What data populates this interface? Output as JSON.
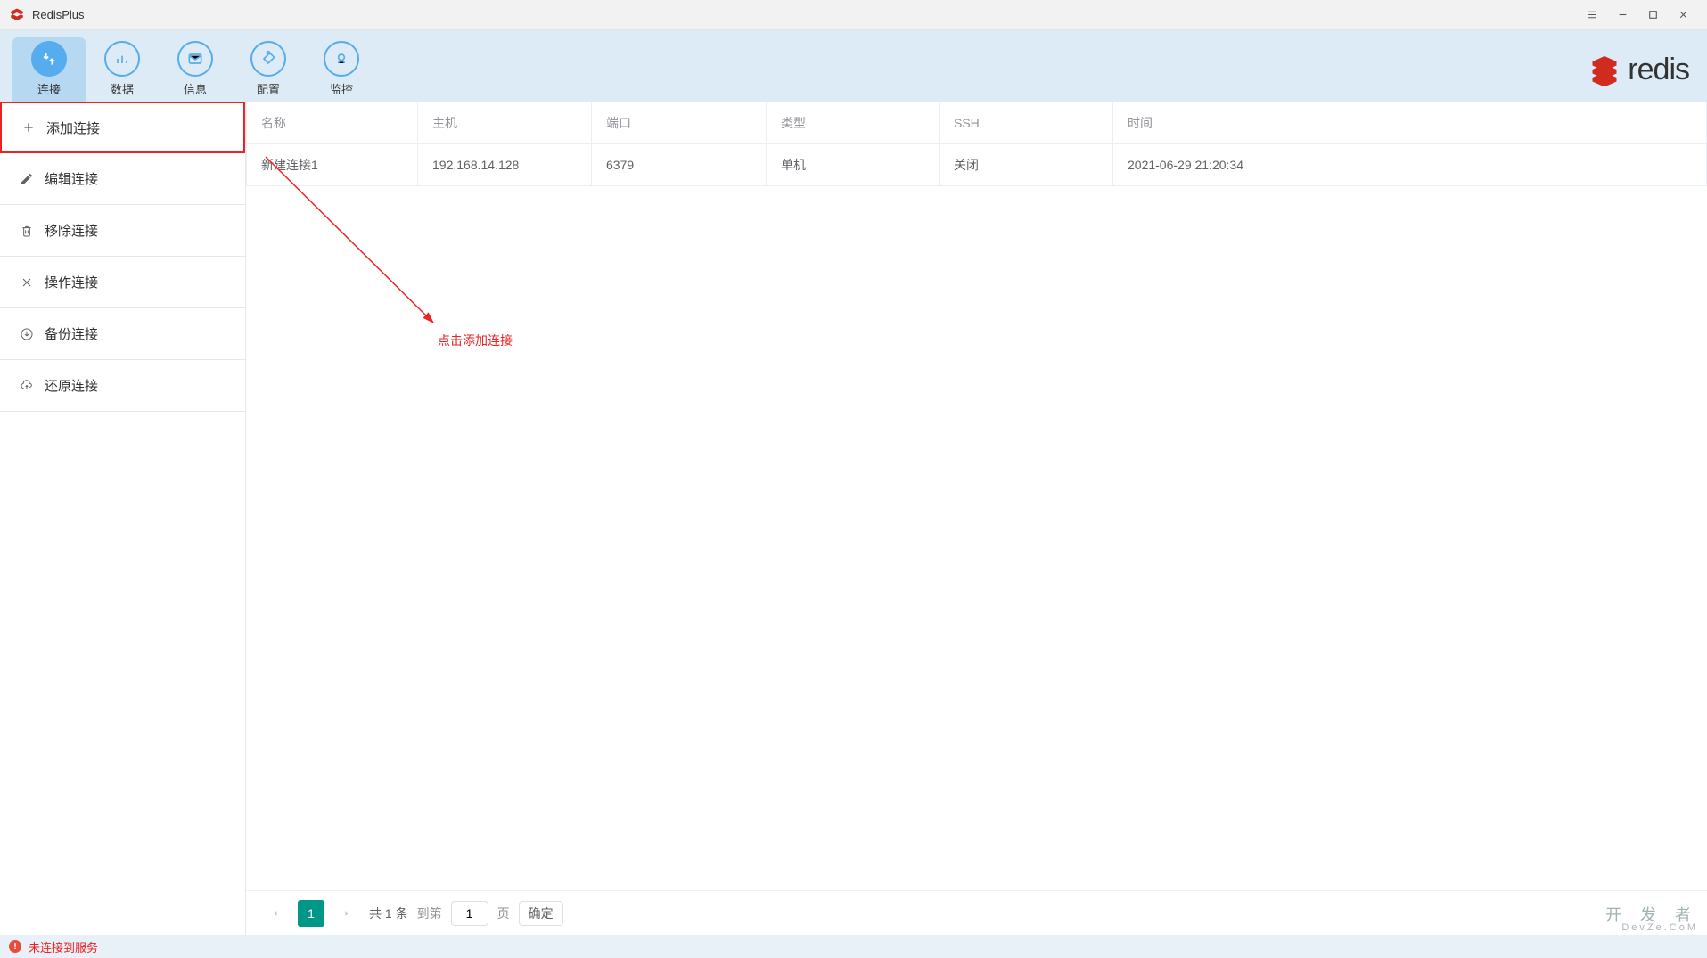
{
  "app": {
    "title": "RedisPlus"
  },
  "toolbar": {
    "items": [
      {
        "label": "连接",
        "icon": "connections"
      },
      {
        "label": "数据",
        "icon": "data"
      },
      {
        "label": "信息",
        "icon": "info"
      },
      {
        "label": "配置",
        "icon": "config"
      },
      {
        "label": "监控",
        "icon": "monitor"
      }
    ],
    "brand": "redis"
  },
  "sidebar": {
    "items": [
      {
        "label": "添加连接",
        "icon": "plus"
      },
      {
        "label": "编辑连接",
        "icon": "pencil"
      },
      {
        "label": "移除连接",
        "icon": "trash"
      },
      {
        "label": "操作连接",
        "icon": "tools"
      },
      {
        "label": "备份连接",
        "icon": "download"
      },
      {
        "label": "还原连接",
        "icon": "upload"
      }
    ]
  },
  "table": {
    "headers": {
      "name": "名称",
      "host": "主机",
      "port": "端口",
      "type": "类型",
      "ssh": "SSH",
      "time": "时间"
    },
    "rows": [
      {
        "name": "新建连接1",
        "host": "192.168.14.128",
        "port": "6379",
        "type": "单机",
        "ssh": "关闭",
        "time": "2021-06-29 21:20:34"
      }
    ]
  },
  "pager": {
    "current": "1",
    "total_text": "共 1 条",
    "goto_label": "到第",
    "page_input": "1",
    "page_unit": "页",
    "ok": "确定"
  },
  "status": {
    "text": "未连接到服务"
  },
  "annotation": {
    "text": "点击添加连接"
  },
  "watermark": {
    "line1": "开 发 者",
    "line2": "DevZe.CoM"
  }
}
